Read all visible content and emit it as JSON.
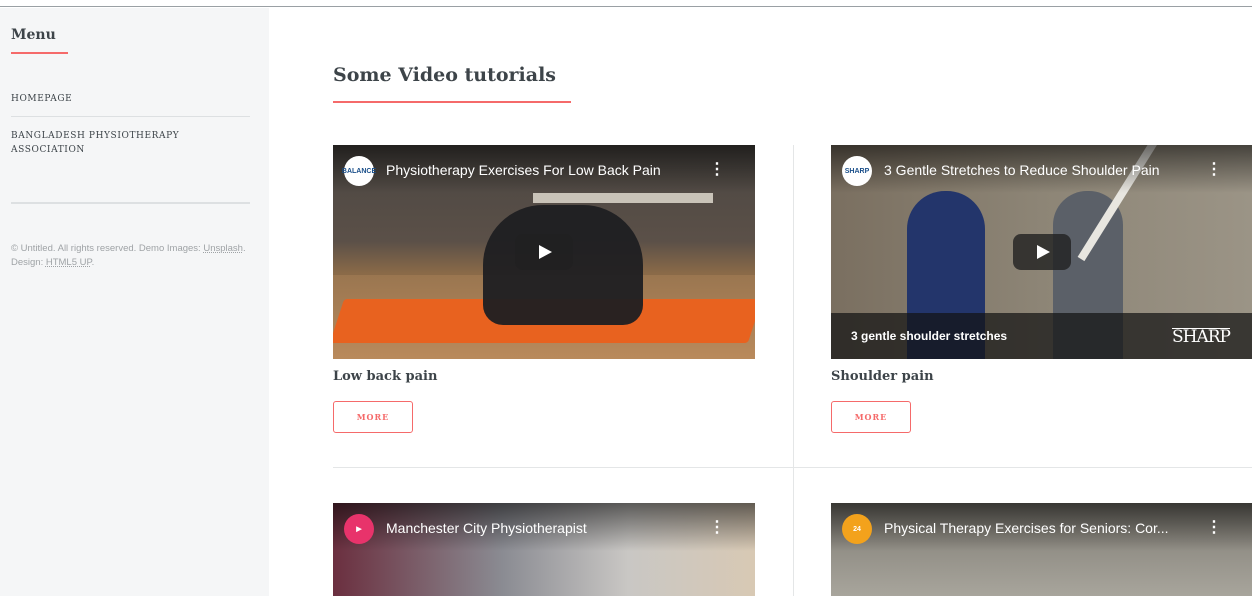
{
  "sidebar": {
    "menu_title": "Menu",
    "items": [
      {
        "label": "HOMEPAGE"
      },
      {
        "label": "BANGLADESH PHYSIOTHERAPY ASSOCIATION"
      }
    ],
    "footer": {
      "text_prefix": "© Untitled. All rights reserved. Demo Images: ",
      "unsplash_link": "Unsplash",
      "design_text": ". Design: ",
      "html5up_link": "HTML5 UP",
      "suffix": "."
    }
  },
  "main": {
    "title": "Some Video tutorials",
    "videos": [
      {
        "video_title": "Physiotherapy Exercises For Low Back Pain",
        "channel": "BALANCE",
        "card_title": "Low back pain",
        "button_label": "MORE"
      },
      {
        "video_title": "3 Gentle Stretches to Reduce Shoulder Pain",
        "channel": "SHARP",
        "banner_text": "3 gentle shoulder stretches",
        "banner_logo": "SHARP",
        "card_title": "Shoulder pain",
        "button_label": "MORE"
      },
      {
        "video_title": "Manchester City Physiotherapist",
        "channel": "",
        "card_title": ""
      },
      {
        "video_title": "Physical Therapy Exercises for Seniors: Cor...",
        "channel": "24",
        "card_title": ""
      }
    ]
  },
  "colors": {
    "accent": "#f56a6a",
    "text": "#3d4449",
    "sidebar_bg": "#f5f6f7"
  }
}
